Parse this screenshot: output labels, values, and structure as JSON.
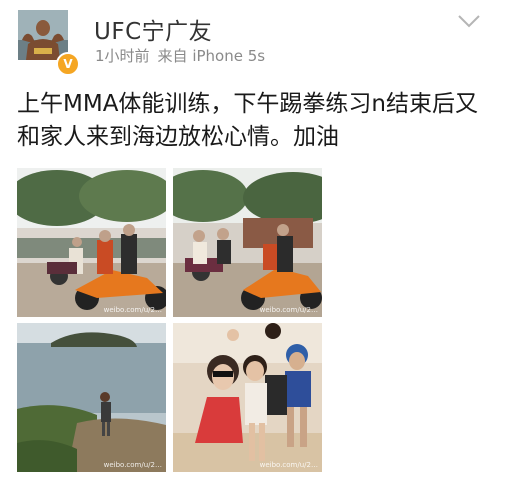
{
  "post": {
    "author": "UFC宁广友",
    "time": "1小时前",
    "source": "来自 iPhone 5s",
    "text": "上午MMA体能训练，下午踢拳练习n结束后又和家人来到海边放松心情。加油",
    "watermark": "weibo.com/u/2…"
  },
  "icons": {
    "verified": "verified-badge-icon",
    "menu": "chevron-down-icon"
  },
  "colors": {
    "verified_badge": "#f5a623",
    "meta_text": "#8a8a8a"
  }
}
